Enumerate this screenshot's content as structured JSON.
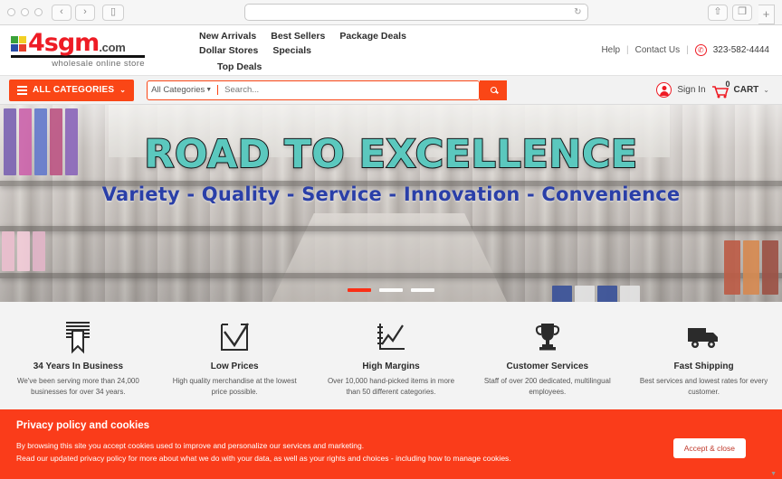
{
  "browser": {
    "back_icon": "‹",
    "forward_icon": "›",
    "sidebar_icon": "▯",
    "address_value": "",
    "address_placeholder": "",
    "reload_icon": "↻",
    "share_icon": "⇧",
    "tabs_icon": "❐",
    "new_tab_icon": "+"
  },
  "header": {
    "logo": {
      "brand": "4sgm",
      "domain": ".com",
      "tagline": "wholesale online store"
    },
    "nav": [
      {
        "label": "New Arrivals"
      },
      {
        "label": "Best Sellers"
      },
      {
        "label": "Package Deals"
      },
      {
        "label": "Dollar Stores"
      },
      {
        "label": "Specials"
      },
      {
        "label": "Top Deals"
      }
    ],
    "utility": {
      "help": "Help",
      "separator": "|",
      "contact": "Contact Us",
      "phone": "323-582-4444",
      "phone_icon": "phone-icon"
    }
  },
  "search_bar": {
    "all_categories_button": "ALL CATEGORIES",
    "all_categories_chevron": "⌄",
    "category_selected": "All Categories",
    "category_options": [
      "All Categories"
    ],
    "search_placeholder": "Search...",
    "search_value": "",
    "search_button_icon": "search-icon",
    "sign_in": "Sign In",
    "cart_label": "CART",
    "cart_count": "0",
    "cart_chevron": "⌄"
  },
  "hero": {
    "title": "ROAD TO EXCELLENCE",
    "subtitle": "Variety - Quality - Service - Innovation - Convenience",
    "slides_total": 3,
    "active_slide": 1,
    "title_color": "#5bc8be",
    "subtitle_color": "#2a3fa8"
  },
  "features": [
    {
      "icon": "bookmark-ribbon-icon",
      "title": "34 Years In Business",
      "desc": "We've been serving more than 24,000 businesses for over 34 years."
    },
    {
      "icon": "checkmark-box-icon",
      "title": "Low Prices",
      "desc": "High quality merchandise at the lowest price possible."
    },
    {
      "icon": "line-chart-icon",
      "title": "High Margins",
      "desc": "Over 10,000 hand-picked items in more than 50 different categories."
    },
    {
      "icon": "trophy-icon",
      "title": "Customer Services",
      "desc": "Staff of over 200 dedicated, multilingual employees."
    },
    {
      "icon": "truck-icon",
      "title": "Fast Shipping",
      "desc": "Best services and lowest rates for every customer."
    }
  ],
  "cookie_banner": {
    "title": "Privacy policy and cookies",
    "line1": "By browsing this site you accept cookies used to improve and personalize our services and marketing.",
    "line2": "Read our updated privacy policy for more about what we do with your data, as well as your rights and choices - including how to manage cookies.",
    "accept_label": "Accept & close",
    "background": "#fa3c1a"
  },
  "colors": {
    "brand_red": "#ee1c25",
    "accent_orange": "#fa4616",
    "feature_bg": "#f3f3f3"
  }
}
